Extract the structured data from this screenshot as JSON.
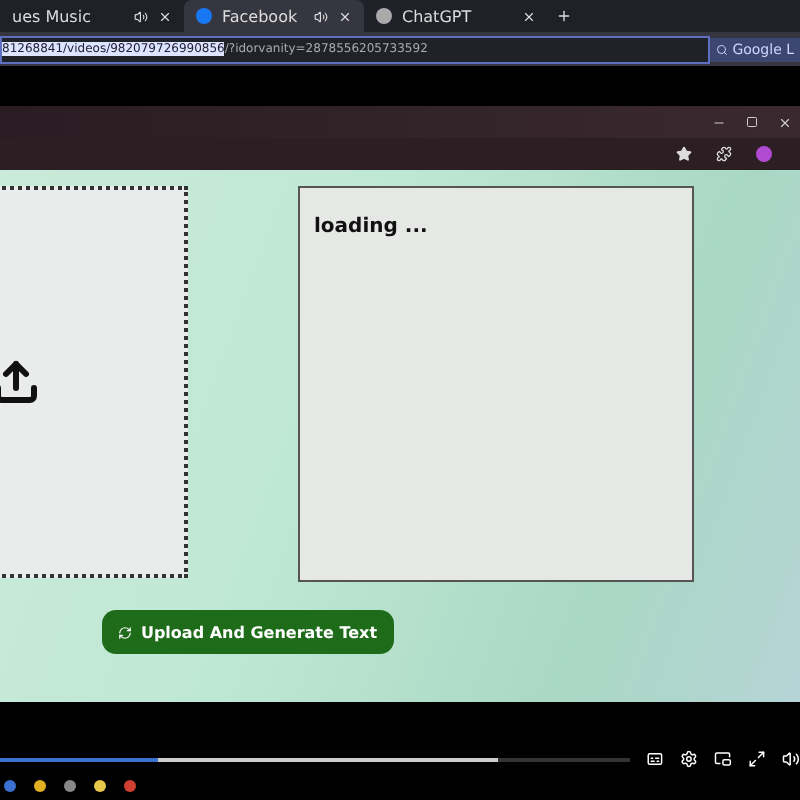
{
  "outer_tabs": [
    {
      "label": "ues Music",
      "selected": false,
      "muted": true
    },
    {
      "label": "Facebook",
      "selected": true,
      "muted": true
    },
    {
      "label": "ChatGPT",
      "selected": false,
      "muted": false
    }
  ],
  "address": {
    "selected_part": "81268841/videos/982079726990856",
    "rest": "/?idorvanity=2878556205733592",
    "lens": "Google L"
  },
  "page": {
    "output_text": "loading ...",
    "button": "Upload And Generate Text"
  },
  "video": {
    "progress": {
      "level": 0.25
    },
    "buffered": {
      "level": 0.79
    }
  }
}
